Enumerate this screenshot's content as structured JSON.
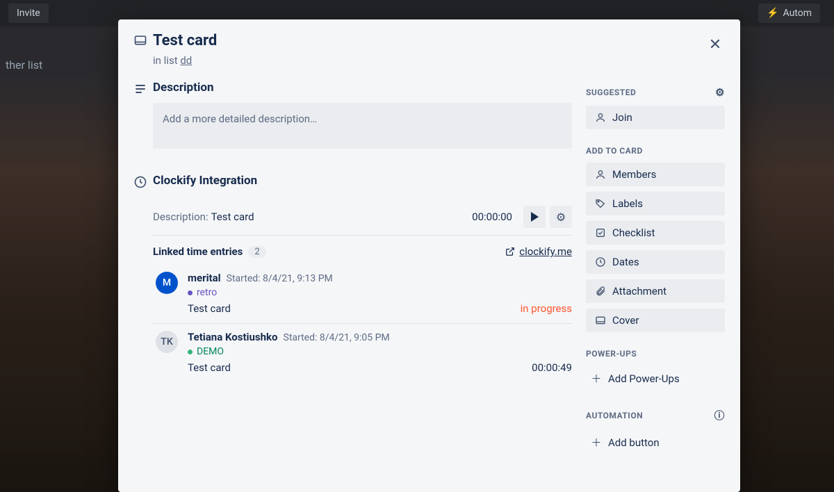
{
  "topbar": {
    "invite": "Invite",
    "automation": "Autom",
    "other_list": "ther list"
  },
  "card": {
    "title": "Test card",
    "in_list_prefix": "in list ",
    "list_name": "dd"
  },
  "description": {
    "heading": "Description",
    "placeholder": "Add a more detailed description…"
  },
  "clockify": {
    "heading": "Clockify Integration",
    "desc_label": "Description: ",
    "desc_value": "Test card",
    "timer": "00:00:00",
    "linked_title": "Linked time entries",
    "linked_count": "2",
    "link_label": "clockify.me",
    "entries": [
      {
        "initials": "M",
        "avatar_class": "blue",
        "name": "merital",
        "started": "Started: 8/4/21, 9:13 PM",
        "tag": "retro",
        "tag_color": "purple",
        "card": "Test card",
        "status": "in progress",
        "status_class": "status-orange"
      },
      {
        "initials": "TK",
        "avatar_class": "grey",
        "name": "Tetiana Kostiushko",
        "started": "Started: 8/4/21, 9:05 PM",
        "tag": "DEMO",
        "tag_color": "green",
        "card": "Test card",
        "status": "00:00:49",
        "status_class": "status-dark"
      }
    ]
  },
  "sidebar": {
    "suggested_title": "SUGGESTED",
    "join": "Join",
    "add_to_card_title": "ADD TO CARD",
    "members": "Members",
    "labels": "Labels",
    "checklist": "Checklist",
    "dates": "Dates",
    "attachment": "Attachment",
    "cover": "Cover",
    "powerups_title": "POWER-UPS",
    "add_powerups": "Add Power-Ups",
    "automation_title": "AUTOMATION",
    "add_button": "Add button"
  }
}
